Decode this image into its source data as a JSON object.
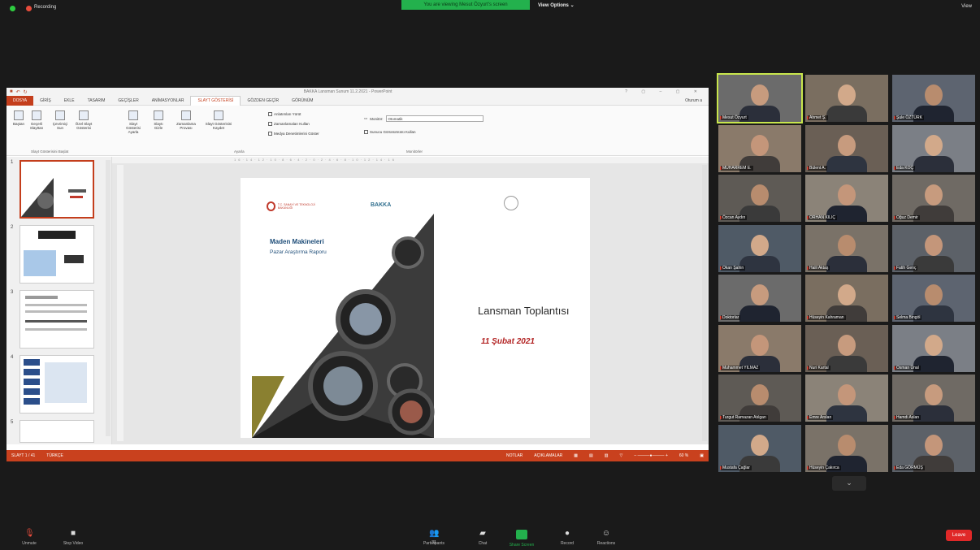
{
  "topbar": {
    "recording": "Recording",
    "view_banner": "You are viewing Mesut Özyurt's screen",
    "view_options": "View Options ⌄",
    "view_button": "View"
  },
  "ppt": {
    "doc_title": "BAKKA Lansman Sunum 11.2.2021 - PowerPoint",
    "tabs": [
      "DOSYA",
      "GİRİŞ",
      "EKLE",
      "TASARIM",
      "GEÇİŞLER",
      "ANİMASYONLAR",
      "SLAYT GÖSTERİSİ",
      "GÖZDEN GEÇİR",
      "GÖRÜNÜM"
    ],
    "active_tab": "SLAYT GÖSTERİSİ",
    "share": "Oturum a",
    "ribbon": {
      "buttons": [
        "Baştan",
        "Geçerli Slayttan",
        "Çevrimiçi Sun",
        "Özel Slayt Gösterisi",
        "Slayt Gösterisi Ayarla",
        "Slaytı Gizle",
        "Zamanlama Provası",
        "Slayt Gösterisini Kaydet"
      ],
      "checks": [
        "Anlatımları Yürüt",
        "Zamanlamaları Kullan",
        "Medya Denetimlerini Göster"
      ],
      "group1": "Slayt Gösterisini Başlat",
      "group2": "Ayarla",
      "group3": "Monitörler",
      "monitor_label": "Monitör:",
      "monitor_value": "Otomatik",
      "presenter_view": "Sunucu Görünümünü Kullan"
    },
    "slide": {
      "report_title": "Maden Makineleri",
      "report_subtitle": "Pazar Araştırma Raporu",
      "title": "Lansman Toplantısı",
      "date": "11 Şubat 2021",
      "logo_text": "BAKKA",
      "ministry": "T.C. SANAYİ VE TEKNOLOJİ BAKANLIĞI"
    },
    "thumb_numbers": [
      "1",
      "2",
      "3",
      "4",
      "5"
    ],
    "status_left": "SLAYT 1 / 41",
    "status_lang": "TÜRKÇE",
    "status_notes": "NOTLAR",
    "status_comments": "AÇIKLAMALAR",
    "zoom": "60 %"
  },
  "gallery": [
    "Mesut Özyurt",
    "Ahmet Ş.",
    "Şule ÖZTÜRK",
    "MUHARREM E.",
    "Bülent A.",
    "Eda KOÇ",
    "Özcan Aydın",
    "ORHAN KILIÇ",
    "Oğuz Demir",
    "Okan Şahin",
    "Halil Aktaş",
    "Fatih Genç",
    "Doktorlar",
    "Hüseyin Kahraman",
    "Selma Bingöl",
    "Muhammet YILMAZ",
    "Nuri Kartal",
    "Osman Ünal",
    "Turgut Ramazan Atılgan",
    "Emre Arslan",
    "Hamdi Aslan",
    "Mustafa Çağlar",
    "Hüseyin Çakırca",
    "Eda GÖRMÜŞ"
  ],
  "toolbar": {
    "unmute": "Unmute",
    "video": "Stop Video",
    "participants": "Participants",
    "participant_count": "31",
    "chat": "Chat",
    "share": "Share Screen",
    "record": "Record",
    "reactions": "Reactions",
    "leave": "Leave"
  },
  "colors": {
    "accent": "#c43e1c",
    "zoom_green": "#23b14d",
    "leave_red": "#e02828"
  }
}
